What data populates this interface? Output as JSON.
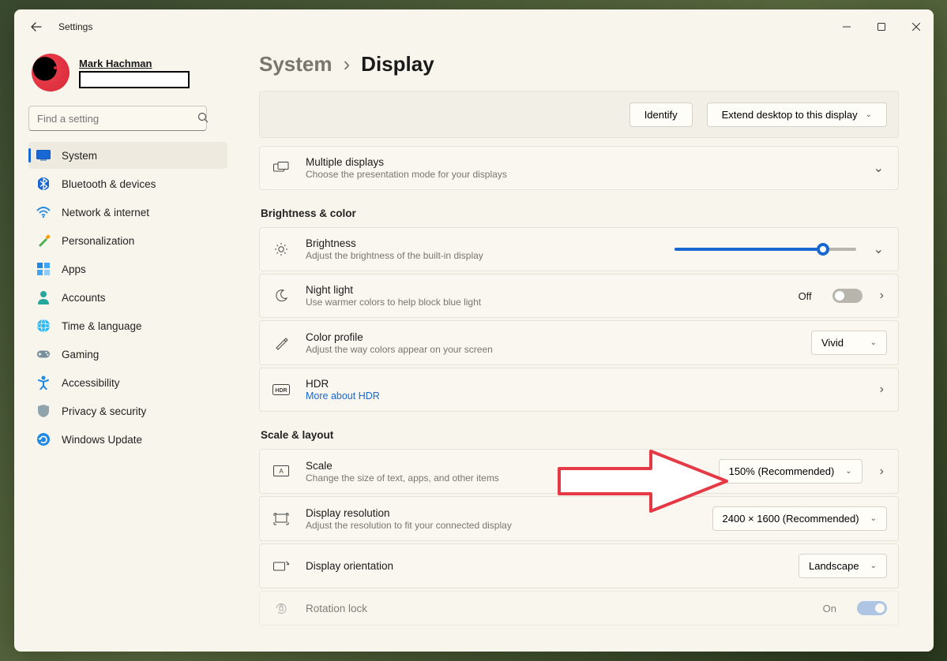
{
  "window": {
    "app_title": "Settings"
  },
  "user": {
    "name": "Mark Hachman"
  },
  "search": {
    "placeholder": "Find a setting"
  },
  "nav": [
    {
      "id": "system",
      "label": "System",
      "icon": "system",
      "active": true
    },
    {
      "id": "bluetooth",
      "label": "Bluetooth & devices",
      "icon": "bluetooth"
    },
    {
      "id": "network",
      "label": "Network & internet",
      "icon": "wifi"
    },
    {
      "id": "personalization",
      "label": "Personalization",
      "icon": "brush"
    },
    {
      "id": "apps",
      "label": "Apps",
      "icon": "apps"
    },
    {
      "id": "accounts",
      "label": "Accounts",
      "icon": "person"
    },
    {
      "id": "time",
      "label": "Time & language",
      "icon": "globe"
    },
    {
      "id": "gaming",
      "label": "Gaming",
      "icon": "gamepad"
    },
    {
      "id": "accessibility",
      "label": "Accessibility",
      "icon": "accessibility"
    },
    {
      "id": "privacy",
      "label": "Privacy & security",
      "icon": "shield"
    },
    {
      "id": "update",
      "label": "Windows Update",
      "icon": "update"
    }
  ],
  "breadcrumb": {
    "parent": "System",
    "current": "Display"
  },
  "identify_panel": {
    "identify_btn": "Identify",
    "extend_label": "Extend desktop to this display"
  },
  "cards": {
    "multiple_displays": {
      "title": "Multiple displays",
      "sub": "Choose the presentation mode for your displays"
    },
    "brightness": {
      "title": "Brightness",
      "sub": "Adjust the brightness of the built-in display",
      "value_pct": 82
    },
    "night_light": {
      "title": "Night light",
      "sub": "Use warmer colors to help block blue light",
      "state_label": "Off",
      "state": false
    },
    "color_profile": {
      "title": "Color profile",
      "sub": "Adjust the way colors appear on your screen",
      "value": "Vivid"
    },
    "hdr": {
      "title": "HDR",
      "link": "More about HDR"
    },
    "scale": {
      "title": "Scale",
      "sub": "Change the size of text, apps, and other items",
      "value": "150% (Recommended)"
    },
    "resolution": {
      "title": "Display resolution",
      "sub": "Adjust the resolution to fit your connected display",
      "value": "2400 × 1600 (Recommended)"
    },
    "orientation": {
      "title": "Display orientation",
      "value": "Landscape"
    },
    "rotation_lock": {
      "title": "Rotation lock",
      "state_label": "On",
      "state": true
    }
  },
  "sections": {
    "brightness_color": "Brightness & color",
    "scale_layout": "Scale & layout"
  }
}
